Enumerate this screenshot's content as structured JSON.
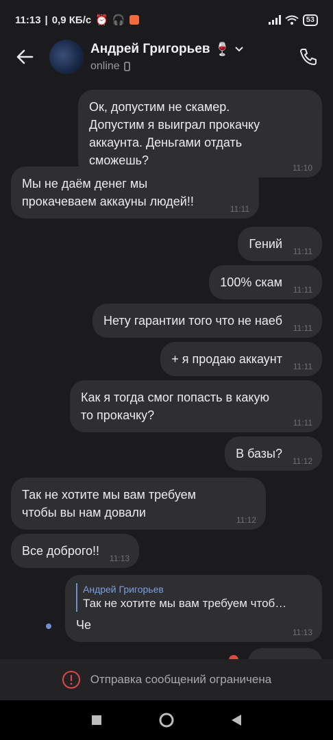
{
  "status_bar": {
    "time": "11:13",
    "speed": "0,9 КБ/с",
    "battery": "53"
  },
  "header": {
    "name": "Андрей Григорьев",
    "name_emoji": "🍷",
    "status": "online"
  },
  "messages": [
    {
      "dir": "out",
      "text": "Ок, допустим не скамер. Допустим я выиграл прокачку аккаунта. Деньгами отдать сможешь?",
      "time": "11:10"
    },
    {
      "dir": "in",
      "text": "Мы не даём денег мы прокачеваем аккауны людей!!",
      "time": "11:11"
    },
    {
      "dir": "out",
      "text": "Гений",
      "time": "11:11"
    },
    {
      "dir": "out",
      "text": "100% скам",
      "time": "11:11"
    },
    {
      "dir": "out",
      "text": "Нету гарантии того что не наеб",
      "time": "11:11"
    },
    {
      "dir": "out",
      "text": "+ я продаю аккаунт",
      "time": "11:11"
    },
    {
      "dir": "out",
      "text": "Как я тогда смог попасть в какую то прокачку?",
      "time": "11:11"
    },
    {
      "dir": "out",
      "text": "В базы?",
      "time": "11:12"
    },
    {
      "dir": "in",
      "text": "Так не хотите мы вам требуем чтобы вы нам довали",
      "time": "11:12"
    },
    {
      "dir": "in",
      "text": "Все доброго!!",
      "time": "11:13"
    },
    {
      "dir": "out",
      "text": "Че",
      "time": "11:13",
      "reply": {
        "author": "Андрей Григорьев",
        "text": "Так не хотите мы вам требуем чтоб…"
      }
    }
  ],
  "restricted_text": "Отправка сообщений ограничена"
}
